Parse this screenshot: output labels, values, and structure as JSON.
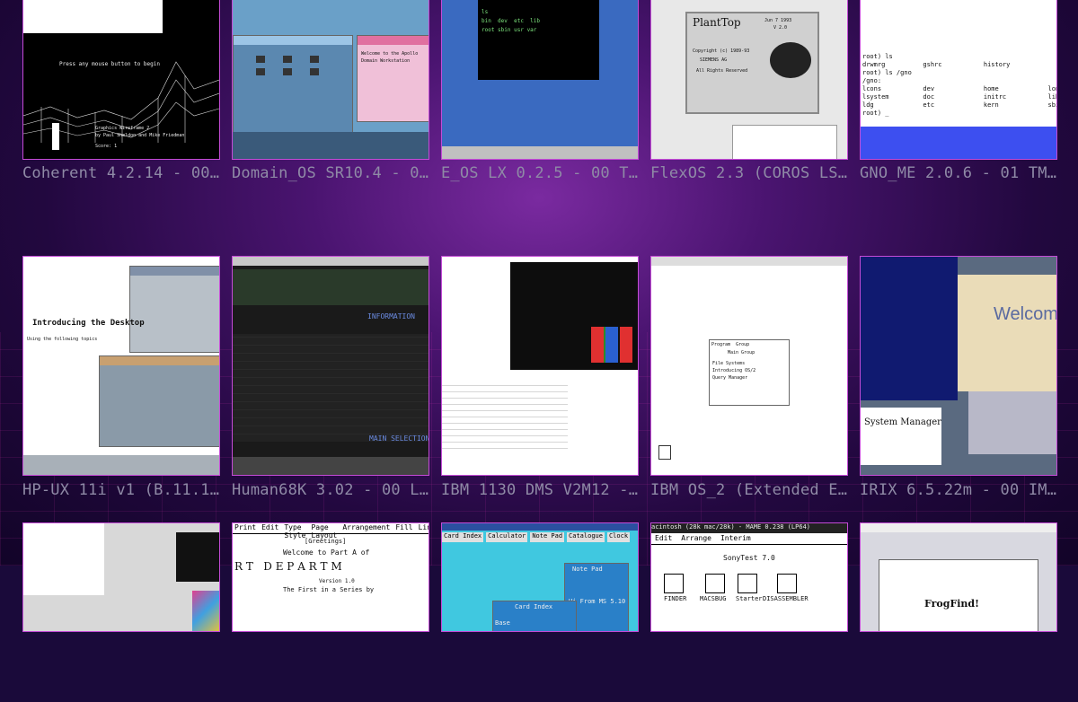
{
  "tiles": [
    {
      "caption": "Coherent 4.2.14 - 00 …",
      "screen": {
        "lines": [
          "Press any mouse button to begin",
          "Graphics Wireframe 2",
          "by Paul Sheldon and Mike Friedman",
          "Score: 1"
        ]
      }
    },
    {
      "caption": "Domain_OS SR10.4 - 01…",
      "screen": {
        "lines": [
          "Welcome to the Apollo",
          "Domain Workstation"
        ]
      }
    },
    {
      "caption": "E_OS LX 0.2.5 - 00 Te…",
      "screen": {
        "lines": [
          "ls",
          "bin  dev  etc  lib",
          "root sbin usr var"
        ]
      }
    },
    {
      "caption": "FlexOS 2.3 (COROS LS-…",
      "screen": {
        "brand": "PlantTop",
        "date": "Jun 7 1993",
        "version": "V 2.0",
        "copyright": "Copyright (c) 1989-93",
        "company": "SIEMENS AG",
        "rights": "All Rights Reserved"
      }
    },
    {
      "caption": "GNO_ME 2.0.6 - 01 TMT…",
      "screen": {
        "lines": [
          "root) ls",
          "drwmrg          gshrc           history",
          "root) ls /gno",
          "/gno:",
          "lcons           dev             home             long",
          "lsystem         doc             initrc           lib",
          "ldg             etc             kern             sbin",
          "root) _"
        ]
      }
    },
    {
      "caption": "HP-UX 11i v1 (B.11.11…",
      "screen": {
        "lines": [
          "Introducing the Desktop",
          "Using the following topics"
        ]
      }
    },
    {
      "caption": "Human68K 3.02 - 00 LH…",
      "screen": {
        "lines": [
          "INFORMATION",
          "MAIN SELECTION"
        ]
      }
    },
    {
      "caption": "IBM 1130 DMS V2M12 - …",
      "screen": {
        "lines": []
      }
    },
    {
      "caption": "IBM OS_2 (Extended Ed…",
      "screen": {
        "lines": [
          "Program  Group",
          "Main Group",
          "File Systems",
          "Introducing OS/2",
          "Query Manager"
        ]
      }
    },
    {
      "caption": "IRIX 6.5.22m - 00 IMD…",
      "screen": {
        "lines": [
          "Welcome",
          "System Manager"
        ]
      }
    },
    {
      "caption": "",
      "screen": {
        "lines": []
      }
    },
    {
      "caption": "",
      "screen": {
        "menu": [
          "Print",
          "Edit",
          "Type Style",
          "Page Layout",
          "Arrangement",
          "Fill",
          "Lines"
        ],
        "greeting": "[Greetings]",
        "lines": [
          "Welcome to Part A of",
          "R T   D E P A R T M",
          "Version 1.0",
          "The First in a Series by"
        ]
      }
    },
    {
      "caption": "",
      "screen": {
        "menu": [
          "Card Index",
          "Calculator",
          "Note Pad",
          "Catalogue",
          "Clock"
        ],
        "lines": [
          "Note Pad",
          "Card Index",
          "Hi From MS 5.10",
          "Base"
        ]
      }
    },
    {
      "caption": "",
      "screen": {
        "titlebar": "acintosh (28k mac/28k) - MAME 0.238 (LP64)",
        "menu": [
          "Edit",
          "Arrange",
          "Interim"
        ],
        "window": "SonyTest 7.0",
        "icons": [
          "FINDER",
          "MACSBUG",
          "Starter",
          "DISASSEMBLER"
        ]
      }
    },
    {
      "caption": "",
      "screen": {
        "lines": [
          "FrogFind!"
        ]
      }
    }
  ]
}
